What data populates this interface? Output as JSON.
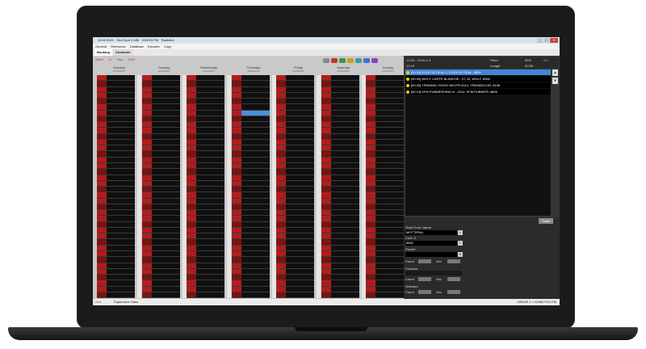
{
  "window": {
    "title": "10:00 0021 · Sea Spot 3.456 · 2/26/15 PM · Radioforl"
  },
  "window_buttons": [
    "_",
    "□",
    "X"
  ],
  "menu": [
    "General",
    "Reference",
    "Database",
    "Exporter",
    "Copy"
  ],
  "tabs": [
    {
      "label": "Booking",
      "active": true
    },
    {
      "label": "Customer",
      "active": false
    }
  ],
  "week_ctrl": {
    "week_label": "Week",
    "week_value": "11",
    "year_label": "Year",
    "year_value": "2015"
  },
  "days": [
    {
      "name": "Monday",
      "date": "10/03/2015"
    },
    {
      "name": "Tuesday",
      "date": "11/03/2015"
    },
    {
      "name": "Wednesday",
      "date": "12/03/2015"
    },
    {
      "name": "Thursday",
      "date": "13/03/2015"
    },
    {
      "name": "Friday",
      "date": "14/03/2015"
    },
    {
      "name": "Saturday",
      "date": "15/03/2015"
    },
    {
      "name": "Sunday",
      "date": "16/03/2015"
    }
  ],
  "info": {
    "time_range": "12:00 - 13:00 # 3",
    "time_value": "12:15",
    "filled_label": "Filled",
    "filled_value": "95%",
    "filled_extra": "0%",
    "length_label": "Length",
    "length_value": "02:55"
  },
  "list": [
    {
      "text": "[00:30] KOOP.JE DEAL 1, KOOP.JE DEAL, 8824",
      "active": true
    },
    {
      "text": "[00:30] WOLF CARTE BLANCHE - 07-15, WOLF, 8266",
      "active": false
    },
    {
      "text": "[00:30] TREMDEC ROOD NEUTR.2014, TREMDECOR, 8198",
      "active": false
    },
    {
      "text": "[00:15] KFM PUBWERVING B - 2014, KFM PUBWER, 8899",
      "active": false
    }
  ],
  "list_scroll": {
    "up": "▲",
    "down": "▼"
  },
  "form": {
    "totals_label": "Totals",
    "short_cust_label": "Short Cust. Name",
    "short_cust_value": "MOTTERAL",
    "cust_no_label": "Cust. #",
    "cust_no_value": "8862",
    "packet_label": "Packet",
    "count_label": "Count",
    "sec_label": "Sec",
    "contract_label": "Contract",
    "selected_label": "Selected"
  },
  "status": {
    "left": "User",
    "supervisor": "Supervisor: Marc",
    "right": "ORASE 1 > KDMLFOO.FM"
  },
  "colors": {
    "slot_red": "#b31c1c",
    "slot_dark": "#101010",
    "selected": "#4a90d9",
    "highlight": "#3f86d6",
    "dot": "#f2d200"
  },
  "icons": {
    "toolbar": [
      "print-icon",
      "copy-icon",
      "save-icon",
      "refresh-icon",
      "filter-icon",
      "info-icon",
      "settings-icon"
    ]
  },
  "selected_slot": {
    "day_index": 3,
    "slot_index": 6
  }
}
